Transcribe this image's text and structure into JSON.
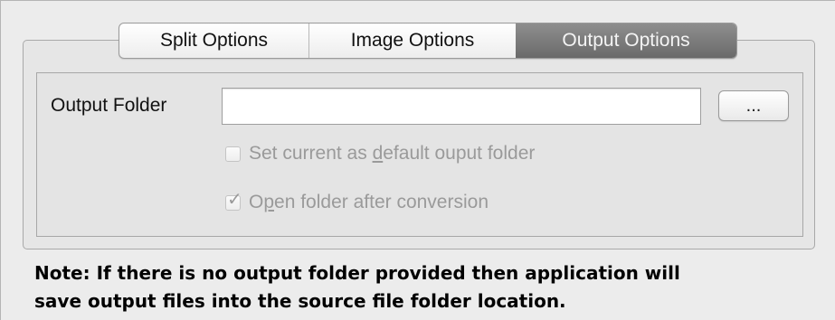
{
  "tabs": [
    {
      "label": "Split Options",
      "selected": false
    },
    {
      "label": "Image Options",
      "selected": false
    },
    {
      "label": "Output Options",
      "selected": true
    }
  ],
  "output": {
    "folder_label": "Output Folder",
    "folder_value": "",
    "browse_label": "..."
  },
  "checkboxes": {
    "default_folder": {
      "label_pre": "Set current as ",
      "label_mnemonic": "d",
      "label_post": "efault ouput folder",
      "checked": false,
      "enabled": false
    },
    "open_folder": {
      "label_pre": "O",
      "label_mnemonic": "p",
      "label_post": "en folder after conversion",
      "checked": true,
      "enabled": false
    }
  },
  "note": {
    "line1": "Note: If there is no output folder provided then application will",
    "line2": "save output files into the source file folder location."
  },
  "colors": {
    "selected_tab_bg": "#7c7c7c",
    "disabled_text": "#9a9a9a",
    "window_bg": "#ececec"
  }
}
